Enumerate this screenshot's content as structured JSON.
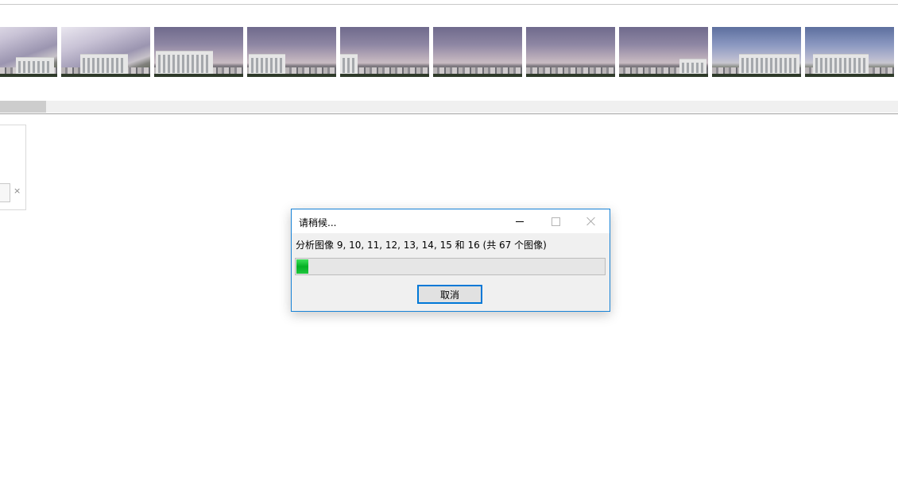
{
  "filmstrip": {
    "thumbnails": [
      {
        "name": "thumbnail-1",
        "style": "bright"
      },
      {
        "name": "thumbnail-2",
        "style": "bright"
      },
      {
        "name": "thumbnail-3",
        "style": "normal"
      },
      {
        "name": "thumbnail-4",
        "style": "normal"
      },
      {
        "name": "thumbnail-5",
        "style": "normal"
      },
      {
        "name": "thumbnail-6",
        "style": "normal"
      },
      {
        "name": "thumbnail-7",
        "style": "normal"
      },
      {
        "name": "thumbnail-8",
        "style": "normal"
      },
      {
        "name": "thumbnail-9",
        "style": "blue"
      },
      {
        "name": "thumbnail-10",
        "style": "blue"
      }
    ]
  },
  "side_panel": {
    "close_glyph": "×"
  },
  "dialog": {
    "title": "请稍候...",
    "message": "分析图像 9, 10, 11, 12, 13, 14, 15 和 16 (共 67 个图像)",
    "progress": 0.04,
    "cancel_label": "取消",
    "accent_color": "#0078d7",
    "progress_color": "#06b025"
  }
}
